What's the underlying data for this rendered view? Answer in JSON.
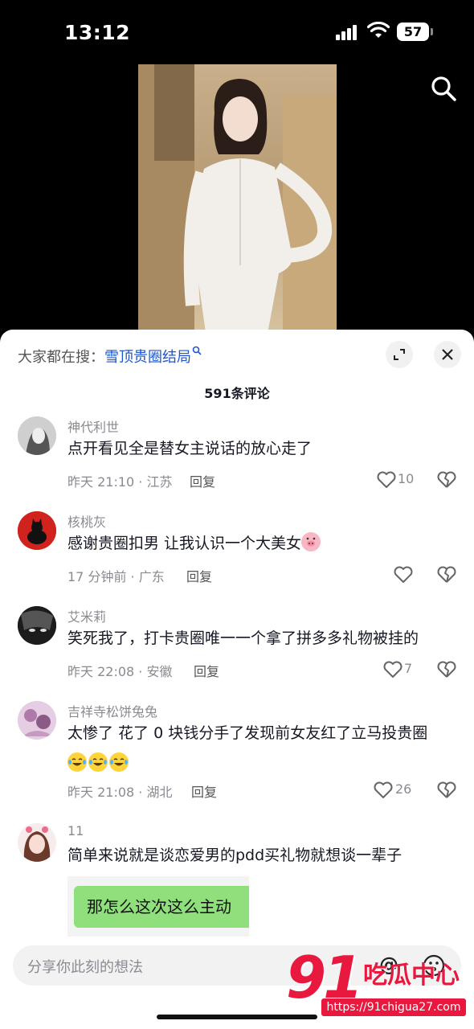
{
  "status_bar": {
    "time": "13:12",
    "battery": "57"
  },
  "video": {
    "search_icon": "search-icon"
  },
  "sheet": {
    "trending_prefix": "大家都在搜：",
    "trending_keyword": "雪顶贵圈结局",
    "comment_count": "591条评论",
    "expand_icon": "expand-icon",
    "close_icon": "close-icon"
  },
  "comments": [
    {
      "user": "神代利世",
      "text": "点开看见全是替女主说话的放心走了",
      "meta": "昨天 21:10 · 江苏",
      "reply": "回复",
      "likes": "10"
    },
    {
      "user": "核桃灰",
      "text": "感谢贵圈扣男 让我认识一个大美女",
      "meta": "17 分钟前 · 广东",
      "reply": "回复",
      "likes": ""
    },
    {
      "user": "艾米莉",
      "text": "笑死我了，打卡贵圈唯一一个拿了拼多多礼物被挂的",
      "meta": "昨天 22:08 · 安徽",
      "reply": "回复",
      "likes": "7"
    },
    {
      "user": "吉祥寺松饼兔兔",
      "text": "太惨了 花了 0 块钱分手了发现前女友红了立马投贵圈",
      "meta": "昨天 21:08 · 湖北",
      "reply": "回复",
      "likes": "26"
    },
    {
      "user": "11",
      "text": "简单来说就是谈恋爱男的pdd买礼物就想谈一辈子",
      "image_text": "那怎么这次这么主动"
    }
  ],
  "input": {
    "placeholder": "分享你此刻的想法",
    "at_symbol": "@"
  },
  "watermark": {
    "big": "91",
    "name": "吃瓜中心",
    "url": "https://91chigua27.com"
  },
  "colors": {
    "accent_link": "#1f56c8",
    "watermark_red": "#e8183f"
  }
}
